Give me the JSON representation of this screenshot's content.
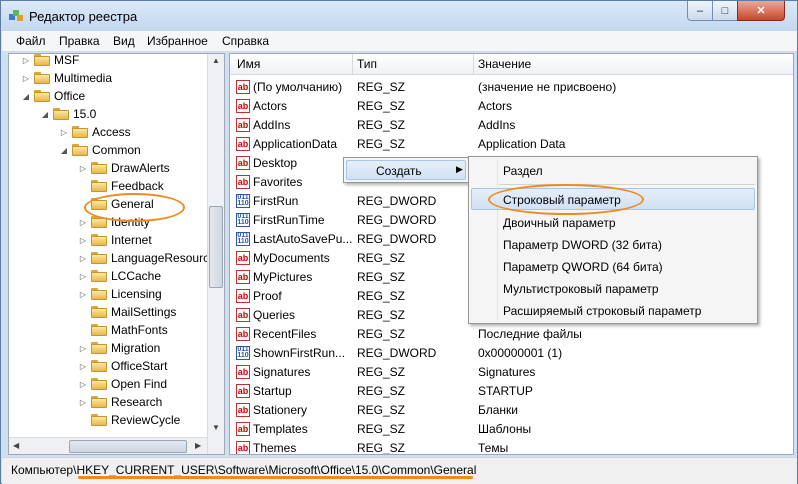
{
  "window": {
    "title": "Редактор реестра",
    "minimize": "–",
    "maximize": "□",
    "close": "✕"
  },
  "menu": [
    "Файл",
    "Правка",
    "Вид",
    "Избранное",
    "Справка"
  ],
  "tree": [
    {
      "label": "MSF",
      "level": 0,
      "expander": "▷"
    },
    {
      "label": "Multimedia",
      "level": 0,
      "expander": "▷"
    },
    {
      "label": "Office",
      "level": 0,
      "expander": "◢"
    },
    {
      "label": "15.0",
      "level": 1,
      "expander": "◢"
    },
    {
      "label": "Access",
      "level": 2,
      "expander": "▷"
    },
    {
      "label": "Common",
      "level": 2,
      "expander": "◢"
    },
    {
      "label": "DrawAlerts",
      "level": 3,
      "expander": "▷"
    },
    {
      "label": "Feedback",
      "level": 3,
      "expander": ""
    },
    {
      "label": "General",
      "level": 3,
      "expander": ""
    },
    {
      "label": "Identity",
      "level": 3,
      "expander": "▷"
    },
    {
      "label": "Internet",
      "level": 3,
      "expander": "▷"
    },
    {
      "label": "LanguageResources",
      "level": 3,
      "expander": "▷"
    },
    {
      "label": "LCCache",
      "level": 3,
      "expander": "▷"
    },
    {
      "label": "Licensing",
      "level": 3,
      "expander": "▷"
    },
    {
      "label": "MailSettings",
      "level": 3,
      "expander": ""
    },
    {
      "label": "MathFonts",
      "level": 3,
      "expander": ""
    },
    {
      "label": "Migration",
      "level": 3,
      "expander": "▷"
    },
    {
      "label": "OfficeStart",
      "level": 3,
      "expander": "▷"
    },
    {
      "label": "Open Find",
      "level": 3,
      "expander": "▷"
    },
    {
      "label": "Research",
      "level": 3,
      "expander": "▷"
    },
    {
      "label": "ReviewCycle",
      "level": 3,
      "expander": ""
    }
  ],
  "columns": {
    "name": "Имя",
    "type": "Тип",
    "value": "Значение"
  },
  "rows": [
    {
      "name": "(По умолчанию)",
      "type": "REG_SZ",
      "value": "(значение не присвоено)",
      "icon": "string"
    },
    {
      "name": "Actors",
      "type": "REG_SZ",
      "value": "Actors",
      "icon": "string"
    },
    {
      "name": "AddIns",
      "type": "REG_SZ",
      "value": "AddIns",
      "icon": "string"
    },
    {
      "name": "ApplicationData",
      "type": "REG_SZ",
      "value": "Application Data",
      "icon": "string"
    },
    {
      "name": "Desktop",
      "type": "",
      "value": "",
      "icon": "string"
    },
    {
      "name": "Favorites",
      "type": "",
      "value": "",
      "icon": "string"
    },
    {
      "name": "FirstRun",
      "type": "REG_DWORD",
      "value": "",
      "icon": "binary"
    },
    {
      "name": "FirstRunTime",
      "type": "REG_DWORD",
      "value": "",
      "icon": "binary"
    },
    {
      "name": "LastAutoSavePu...",
      "type": "REG_DWORD",
      "value": "",
      "icon": "binary"
    },
    {
      "name": "MyDocuments",
      "type": "REG_SZ",
      "value": "",
      "icon": "string"
    },
    {
      "name": "MyPictures",
      "type": "REG_SZ",
      "value": "",
      "icon": "string"
    },
    {
      "name": "Proof",
      "type": "REG_SZ",
      "value": "",
      "icon": "string"
    },
    {
      "name": "Queries",
      "type": "REG_SZ",
      "value": "",
      "icon": "string"
    },
    {
      "name": "RecentFiles",
      "type": "REG_SZ",
      "value": "Последние файлы",
      "icon": "string"
    },
    {
      "name": "ShownFirstRun...",
      "type": "REG_DWORD",
      "value": "0x00000001 (1)",
      "icon": "binary"
    },
    {
      "name": "Signatures",
      "type": "REG_SZ",
      "value": "Signatures",
      "icon": "string"
    },
    {
      "name": "Startup",
      "type": "REG_SZ",
      "value": "STARTUP",
      "icon": "string"
    },
    {
      "name": "Stationery",
      "type": "REG_SZ",
      "value": "Бланки",
      "icon": "string"
    },
    {
      "name": "Templates",
      "type": "REG_SZ",
      "value": "Шаблоны",
      "icon": "string"
    },
    {
      "name": "Themes",
      "type": "REG_SZ",
      "value": "Темы",
      "icon": "string"
    }
  ],
  "context_menu": {
    "create": "Создать"
  },
  "submenu": [
    "Раздел",
    "Строковый параметр",
    "Двоичный параметр",
    "Параметр DWORD (32 бита)",
    "Параметр QWORD (64 бита)",
    "Мультистроковый параметр",
    "Расширяемый строковый параметр"
  ],
  "status": {
    "path": "Компьютер\\HKEY_CURRENT_USER\\Software\\Microsoft\\Office\\15.0\\Common\\General"
  },
  "icons": {
    "string": "ab",
    "binary": "011 110"
  },
  "colors": {
    "highlight_oval": "#f08a1c"
  }
}
